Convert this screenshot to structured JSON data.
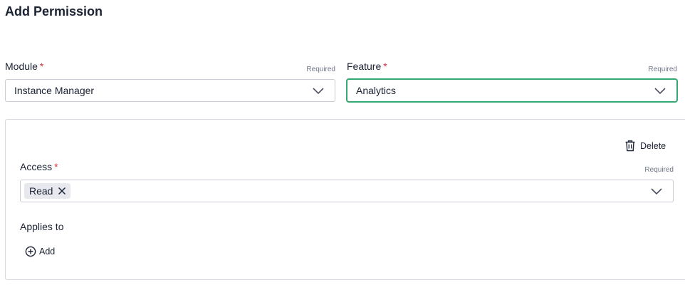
{
  "page": {
    "title": "Add Permission"
  },
  "module": {
    "label": "Module",
    "required_mark": "*",
    "required_hint": "Required",
    "value": "Instance Manager"
  },
  "feature": {
    "label": "Feature",
    "required_mark": "*",
    "required_hint": "Required",
    "value": "Analytics"
  },
  "permission": {
    "delete_label": "Delete",
    "access": {
      "label": "Access",
      "required_mark": "*",
      "required_hint": "Required",
      "tags": [
        "Read"
      ]
    },
    "applies_to": {
      "label": "Applies to",
      "add_label": "Add"
    }
  },
  "colors": {
    "accent_focus": "#33a872",
    "required_star": "#d6303b",
    "text": "#1b2233"
  },
  "icons": [
    "chevron-down-icon",
    "trash-icon",
    "close-icon",
    "plus-circle-icon"
  ]
}
